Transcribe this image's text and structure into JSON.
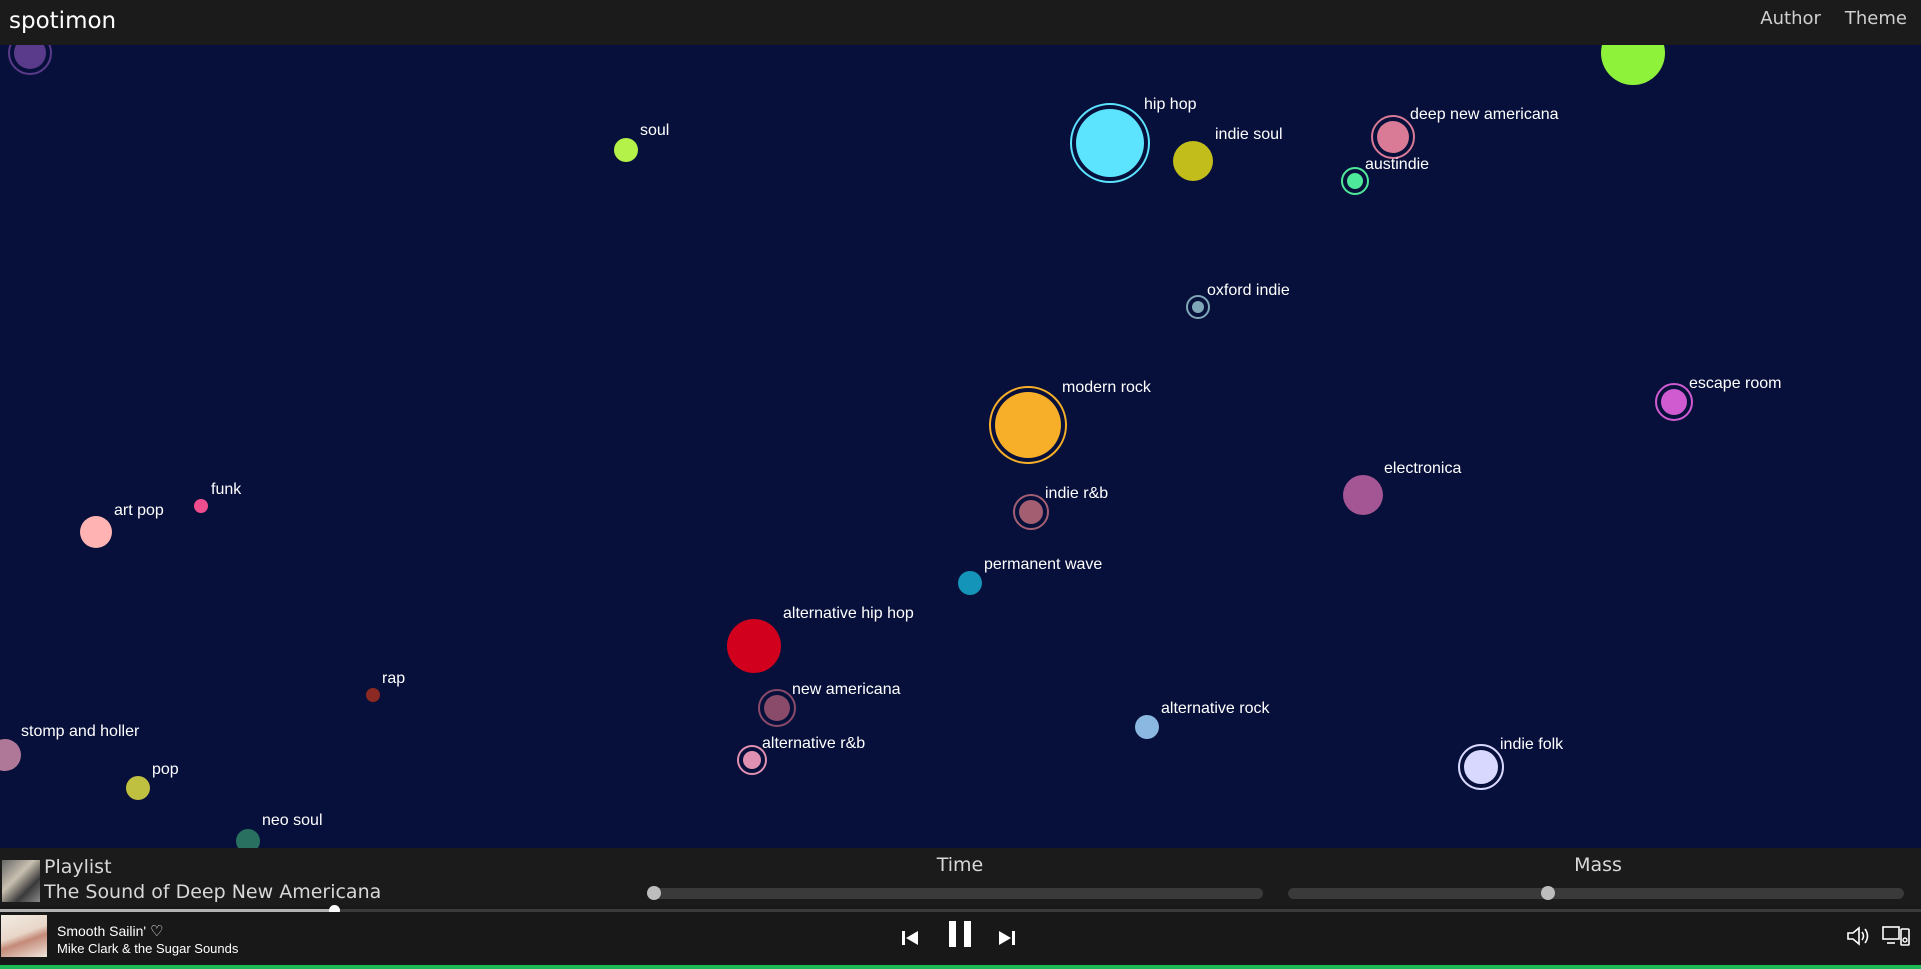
{
  "app": {
    "title": "spotimon",
    "nav": [
      "Author",
      "Theme"
    ]
  },
  "graph": {
    "nodes": [
      {
        "label": "",
        "color": "#5a3a8a",
        "ring": true
      },
      {
        "label": "",
        "color": "#8ef23a",
        "ring": false
      },
      {
        "label": "soul",
        "color": "#b4f24a",
        "ring": false
      },
      {
        "label": "hip hop",
        "color": "#5ce4ff",
        "ring": true
      },
      {
        "label": "indie soul",
        "color": "#c2bd1a",
        "ring": false
      },
      {
        "label": "deep new americana",
        "color": "#d97a96",
        "ring": true
      },
      {
        "label": "austindie",
        "color": "#4ee89a",
        "ring": true
      },
      {
        "label": "oxford indie",
        "color": "#7fa7b8",
        "ring": true
      },
      {
        "label": "modern rock",
        "color": "#f7ae28",
        "ring": true
      },
      {
        "label": "escape room",
        "color": "#d05ad0",
        "ring": true
      },
      {
        "label": "electronica",
        "color": "#a35594",
        "ring": false
      },
      {
        "label": "indie r&b",
        "color": "#a35e72",
        "ring": true
      },
      {
        "label": "funk",
        "color": "#f04d8e",
        "ring": false
      },
      {
        "label": "art pop",
        "color": "#ffb3b3",
        "ring": false
      },
      {
        "label": "permanent wave",
        "color": "#1494b8",
        "ring": false
      },
      {
        "label": "alternative hip hop",
        "color": "#d1001c",
        "ring": false
      },
      {
        "label": "rap",
        "color": "#8a2a22",
        "ring": false
      },
      {
        "label": "new americana",
        "color": "#8a4a6a",
        "ring": true
      },
      {
        "label": "alternative rock",
        "color": "#8ab8e0",
        "ring": false
      },
      {
        "label": "alternative r&b",
        "color": "#e090b0",
        "ring": true
      },
      {
        "label": "indie folk",
        "color": "#d8d8ff",
        "ring": true
      },
      {
        "label": "stomp and holler",
        "color": "#b07898",
        "ring": false
      },
      {
        "label": "pop",
        "color": "#c0c040",
        "ring": false
      },
      {
        "label": "neo soul",
        "color": "#2a7060",
        "ring": false
      }
    ]
  },
  "controls": {
    "playlist_kicker": "Playlist",
    "playlist_name": "The Sound of Deep New Americana",
    "time_label": "Time",
    "mass_label": "Mass",
    "time_value": 0.0,
    "mass_value": 0.42
  },
  "player": {
    "track_title": "Smooth Sailin'",
    "track_artist": "Mike Clark & the Sugar Sounds",
    "progress": 0.174
  }
}
